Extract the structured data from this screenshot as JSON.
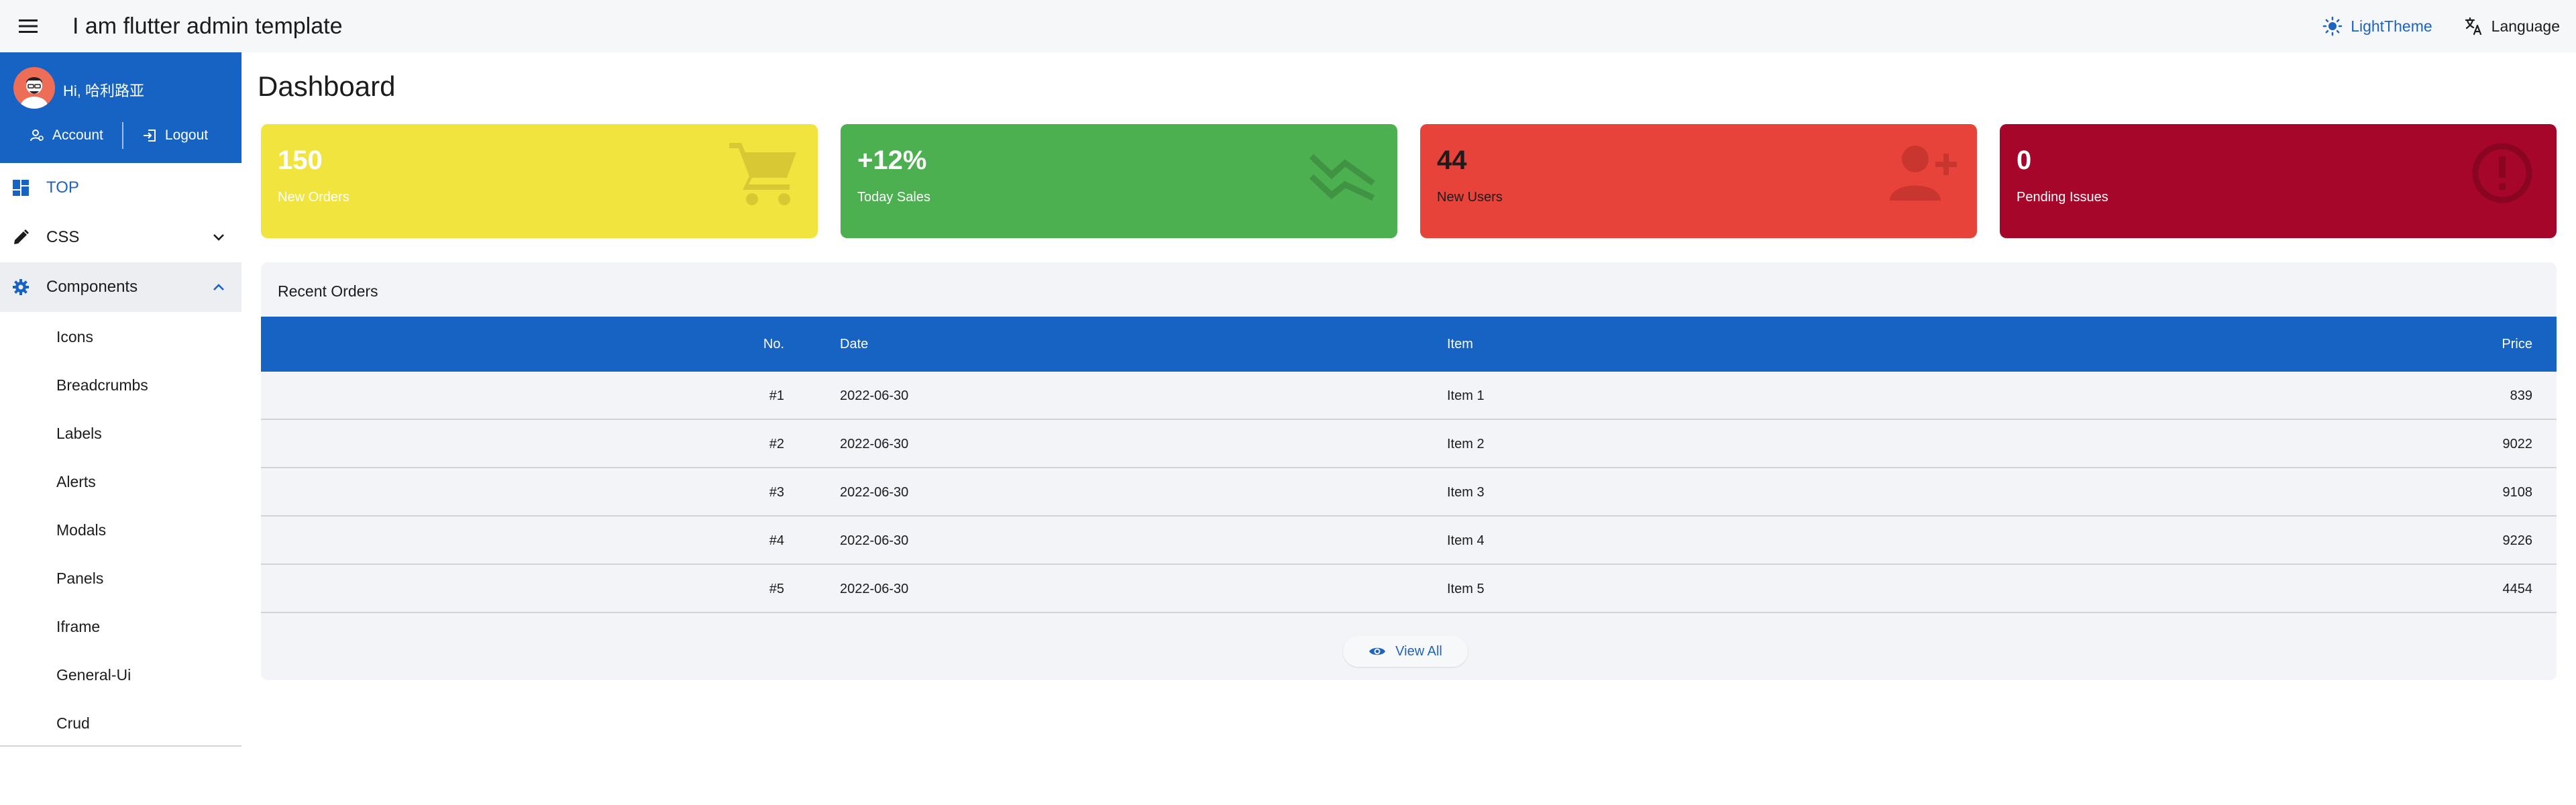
{
  "appbar": {
    "title": "I am flutter admin template",
    "theme_label": "LightTheme",
    "language_label": "Language"
  },
  "sidebar": {
    "greeting": "Hi, 哈利路亚",
    "account_label": "Account",
    "logout_label": "Logout",
    "nav": [
      {
        "label": "TOP",
        "icon": "dashboard-icon",
        "active": true
      },
      {
        "label": "CSS",
        "icon": "pencil-icon",
        "chevron": "chevron-down-icon"
      },
      {
        "label": "Components",
        "icon": "gear-icon",
        "chevron": "chevron-up-icon",
        "expanded": true
      }
    ],
    "sub_items": [
      "Icons",
      "Breadcrumbs",
      "Labels",
      "Alerts",
      "Modals",
      "Panels",
      "Iframe",
      "General-Ui",
      "Crud"
    ]
  },
  "page": {
    "title": "Dashboard"
  },
  "cards": [
    {
      "value": "150",
      "caption": "New Orders",
      "color": "#f2e43f",
      "text_color": "#ffffff",
      "icon": "cart-icon"
    },
    {
      "value": "+12%",
      "caption": "Today Sales",
      "color": "#4caf50",
      "text_color": "#ffffff",
      "icon": "trend-icon"
    },
    {
      "value": "44",
      "caption": "New Users",
      "color": "#e8433b",
      "text_color": "#1c1c1c",
      "icon": "add-user-icon"
    },
    {
      "value": "0",
      "caption": "Pending Issues",
      "color": "#a50629",
      "text_color": "#ffffff",
      "icon": "alert-icon"
    }
  ],
  "orders": {
    "title": "Recent Orders",
    "columns": {
      "no": "No.",
      "date": "Date",
      "item": "Item",
      "price": "Price"
    },
    "rows": [
      {
        "no": "#1",
        "date": "2022-06-30",
        "item": "Item 1",
        "price": "839"
      },
      {
        "no": "#2",
        "date": "2022-06-30",
        "item": "Item 2",
        "price": "9022"
      },
      {
        "no": "#3",
        "date": "2022-06-30",
        "item": "Item 3",
        "price": "9108"
      },
      {
        "no": "#4",
        "date": "2022-06-30",
        "item": "Item 4",
        "price": "9226"
      },
      {
        "no": "#5",
        "date": "2022-06-30",
        "item": "Item 5",
        "price": "4454"
      }
    ],
    "view_all_label": "View All"
  },
  "colors": {
    "primary": "#1763c4",
    "accent_text": "#1e63bf"
  }
}
